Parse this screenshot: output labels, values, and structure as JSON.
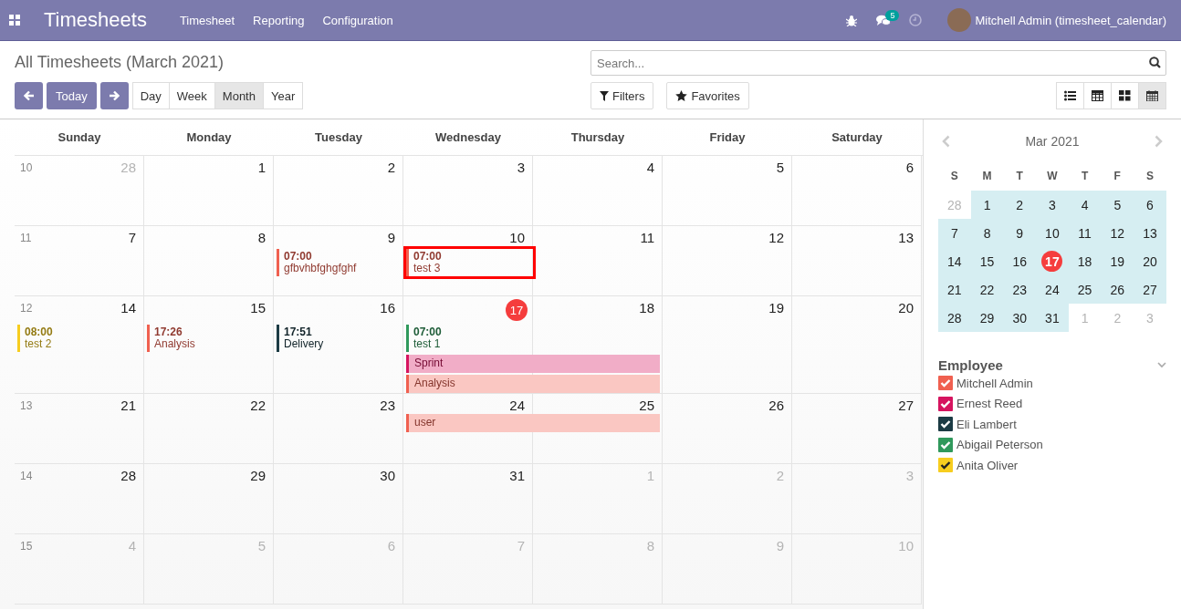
{
  "navbar": {
    "app_title": "Timesheets",
    "menu": [
      "Timesheet",
      "Reporting",
      "Configuration"
    ],
    "message_count": "5",
    "user": "Mitchell Admin (timesheet_calendar)"
  },
  "control_panel": {
    "title": "All Timesheets (March 2021)",
    "today_button": "Today",
    "scales": [
      {
        "label": "Day",
        "selected": false
      },
      {
        "label": "Week",
        "selected": false
      },
      {
        "label": "Month",
        "selected": true
      },
      {
        "label": "Year",
        "selected": false
      }
    ],
    "search": {
      "placeholder": "Search..."
    },
    "filters_button": "Filters",
    "favorites_button": "Favorites",
    "views": [
      {
        "kind": "list",
        "selected": false
      },
      {
        "kind": "pivot",
        "selected": false
      },
      {
        "kind": "kanban",
        "selected": false
      },
      {
        "kind": "calendar",
        "selected": true
      }
    ]
  },
  "calendar": {
    "weekdays": [
      "Sunday",
      "Monday",
      "Tuesday",
      "Wednesday",
      "Thursday",
      "Friday",
      "Saturday"
    ],
    "weeks": [
      {
        "number": "10",
        "days": [
          {
            "label": "28",
            "other_month": true,
            "today": false
          },
          {
            "label": "1",
            "other_month": false,
            "today": false
          },
          {
            "label": "2",
            "other_month": false,
            "today": false
          },
          {
            "label": "3",
            "other_month": false,
            "today": false
          },
          {
            "label": "4",
            "other_month": false,
            "today": false
          },
          {
            "label": "5",
            "other_month": false,
            "today": false
          },
          {
            "label": "6",
            "other_month": false,
            "today": false
          }
        ]
      },
      {
        "number": "11",
        "days": [
          {
            "label": "7",
            "other_month": false,
            "today": false
          },
          {
            "label": "8",
            "other_month": false,
            "today": false
          },
          {
            "label": "9",
            "other_month": false,
            "today": false,
            "events": [
              {
                "kind": "timed",
                "time": "07:00",
                "title": "gfbvhbfghgfghf",
                "color": "#f06050",
                "highlighted": false
              }
            ]
          },
          {
            "label": "10",
            "other_month": false,
            "today": false,
            "events": [
              {
                "kind": "timed",
                "time": "07:00",
                "title": "test 3",
                "color": "#f06050",
                "highlighted": true
              }
            ]
          },
          {
            "label": "11",
            "other_month": false,
            "today": false
          },
          {
            "label": "12",
            "other_month": false,
            "today": false
          },
          {
            "label": "13",
            "other_month": false,
            "today": false
          }
        ]
      },
      {
        "number": "12",
        "days": [
          {
            "label": "14",
            "other_month": false,
            "today": false,
            "events": [
              {
                "kind": "timed",
                "time": "08:00",
                "title": "test 2",
                "color": "#f7cd1f",
                "highlighted": false
              }
            ]
          },
          {
            "label": "15",
            "other_month": false,
            "today": false,
            "events": [
              {
                "kind": "timed",
                "time": "17:26",
                "title": "Analysis",
                "color": "#f06050",
                "highlighted": false
              }
            ]
          },
          {
            "label": "16",
            "other_month": false,
            "today": false,
            "events": [
              {
                "kind": "timed",
                "time": "17:51",
                "title": "Delivery",
                "color": "#1c3b44",
                "highlighted": false
              }
            ]
          },
          {
            "label": "17",
            "other_month": false,
            "today": true,
            "events": [
              {
                "kind": "timed",
                "time": "07:00",
                "title": "test 1",
                "color": "#30995c",
                "highlighted": false
              },
              {
                "kind": "all_day",
                "title": "Sprint",
                "color": "#d6145f",
                "continues_next_day": true,
                "highlighted": false
              },
              {
                "kind": "all_day",
                "title": "Analysis",
                "color": "#f06050",
                "continues_next_day": true,
                "highlighted": false
              }
            ]
          },
          {
            "label": "18",
            "other_month": false,
            "today": false
          },
          {
            "label": "19",
            "other_month": false,
            "today": false
          },
          {
            "label": "20",
            "other_month": false,
            "today": false
          }
        ]
      },
      {
        "number": "13",
        "days": [
          {
            "label": "21",
            "other_month": false,
            "today": false
          },
          {
            "label": "22",
            "other_month": false,
            "today": false
          },
          {
            "label": "23",
            "other_month": false,
            "today": false
          },
          {
            "label": "24",
            "other_month": false,
            "today": false,
            "events": [
              {
                "kind": "all_day",
                "title": "user",
                "color": "#f06050",
                "continues_next_day": true,
                "highlighted": false
              }
            ]
          },
          {
            "label": "25",
            "other_month": false,
            "today": false
          },
          {
            "label": "26",
            "other_month": false,
            "today": false
          },
          {
            "label": "27",
            "other_month": false,
            "today": false
          }
        ]
      },
      {
        "number": "14",
        "days": [
          {
            "label": "28",
            "other_month": false,
            "today": false
          },
          {
            "label": "29",
            "other_month": false,
            "today": false
          },
          {
            "label": "30",
            "other_month": false,
            "today": false
          },
          {
            "label": "31",
            "other_month": false,
            "today": false
          },
          {
            "label": "1",
            "other_month": true,
            "today": false
          },
          {
            "label": "2",
            "other_month": true,
            "today": false
          },
          {
            "label": "3",
            "other_month": true,
            "today": false
          }
        ]
      },
      {
        "number": "15",
        "days": [
          {
            "label": "4",
            "other_month": true,
            "today": false
          },
          {
            "label": "5",
            "other_month": true,
            "today": false
          },
          {
            "label": "6",
            "other_month": true,
            "today": false
          },
          {
            "label": "7",
            "other_month": true,
            "today": false
          },
          {
            "label": "8",
            "other_month": true,
            "today": false
          },
          {
            "label": "9",
            "other_month": true,
            "today": false
          },
          {
            "label": "10",
            "other_month": true,
            "today": false
          }
        ]
      }
    ]
  },
  "sidebar": {
    "mini_calendar": {
      "title": "Mar 2021",
      "weekdays": [
        "S",
        "M",
        "T",
        "W",
        "T",
        "F",
        "S"
      ],
      "weeks": [
        [
          {
            "label": "28",
            "other_month": true,
            "in_range": false,
            "today": false
          },
          {
            "label": "1",
            "other_month": false,
            "in_range": true,
            "today": false
          },
          {
            "label": "2",
            "other_month": false,
            "in_range": true,
            "today": false
          },
          {
            "label": "3",
            "other_month": false,
            "in_range": true,
            "today": false
          },
          {
            "label": "4",
            "other_month": false,
            "in_range": true,
            "today": false
          },
          {
            "label": "5",
            "other_month": false,
            "in_range": true,
            "today": false
          },
          {
            "label": "6",
            "other_month": false,
            "in_range": true,
            "today": false
          }
        ],
        [
          {
            "label": "7",
            "other_month": false,
            "in_range": true,
            "today": false
          },
          {
            "label": "8",
            "other_month": false,
            "in_range": true,
            "today": false
          },
          {
            "label": "9",
            "other_month": false,
            "in_range": true,
            "today": false
          },
          {
            "label": "10",
            "other_month": false,
            "in_range": true,
            "today": false
          },
          {
            "label": "11",
            "other_month": false,
            "in_range": true,
            "today": false
          },
          {
            "label": "12",
            "other_month": false,
            "in_range": true,
            "today": false
          },
          {
            "label": "13",
            "other_month": false,
            "in_range": true,
            "today": false
          }
        ],
        [
          {
            "label": "14",
            "other_month": false,
            "in_range": true,
            "today": false
          },
          {
            "label": "15",
            "other_month": false,
            "in_range": true,
            "today": false
          },
          {
            "label": "16",
            "other_month": false,
            "in_range": true,
            "today": false
          },
          {
            "label": "17",
            "other_month": false,
            "in_range": true,
            "today": true
          },
          {
            "label": "18",
            "other_month": false,
            "in_range": true,
            "today": false
          },
          {
            "label": "19",
            "other_month": false,
            "in_range": true,
            "today": false
          },
          {
            "label": "20",
            "other_month": false,
            "in_range": true,
            "today": false
          }
        ],
        [
          {
            "label": "21",
            "other_month": false,
            "in_range": true,
            "today": false
          },
          {
            "label": "22",
            "other_month": false,
            "in_range": true,
            "today": false
          },
          {
            "label": "23",
            "other_month": false,
            "in_range": true,
            "today": false
          },
          {
            "label": "24",
            "other_month": false,
            "in_range": true,
            "today": false
          },
          {
            "label": "25",
            "other_month": false,
            "in_range": true,
            "today": false
          },
          {
            "label": "26",
            "other_month": false,
            "in_range": true,
            "today": false
          },
          {
            "label": "27",
            "other_month": false,
            "in_range": true,
            "today": false
          }
        ],
        [
          {
            "label": "28",
            "other_month": false,
            "in_range": true,
            "today": false
          },
          {
            "label": "29",
            "other_month": false,
            "in_range": true,
            "today": false
          },
          {
            "label": "30",
            "other_month": false,
            "in_range": true,
            "today": false
          },
          {
            "label": "31",
            "other_month": false,
            "in_range": true,
            "today": false
          },
          {
            "label": "1",
            "other_month": true,
            "in_range": false,
            "today": false
          },
          {
            "label": "2",
            "other_month": true,
            "in_range": false,
            "today": false
          },
          {
            "label": "3",
            "other_month": true,
            "in_range": false,
            "today": false
          }
        ]
      ]
    },
    "filter": {
      "title": "Employee",
      "expanded": true,
      "items": [
        {
          "label": "Mitchell Admin",
          "checked": true,
          "color": "#f06050"
        },
        {
          "label": "Ernest Reed",
          "checked": true,
          "color": "#d6145f"
        },
        {
          "label": "Eli Lambert",
          "checked": true,
          "color": "#1c3b44"
        },
        {
          "label": "Abigail Peterson",
          "checked": true,
          "color": "#30995c"
        },
        {
          "label": "Anita Oliver",
          "checked": true,
          "color": "#f7cd1f"
        }
      ]
    }
  }
}
